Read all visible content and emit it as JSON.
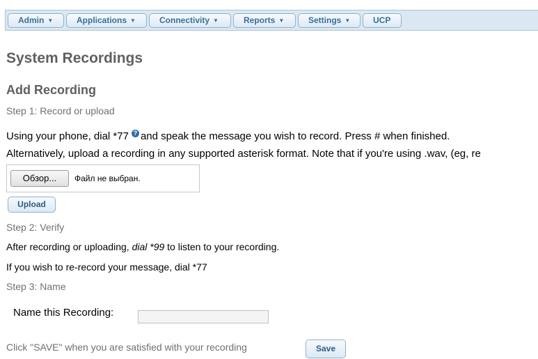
{
  "nav": {
    "items": [
      {
        "label": "Admin",
        "has_dropdown": true
      },
      {
        "label": "Applications",
        "has_dropdown": true
      },
      {
        "label": "Connectivity",
        "has_dropdown": true
      },
      {
        "label": "Reports",
        "has_dropdown": true
      },
      {
        "label": "Settings",
        "has_dropdown": true
      },
      {
        "label": "UCP",
        "has_dropdown": false
      }
    ],
    "caret": "▼"
  },
  "page_title": "System Recordings",
  "section_title": "Add Recording",
  "step1": {
    "label": "Step 1: Record or upload",
    "instruction_pre": "Using your phone, dial *77",
    "help_icon": "?",
    "instruction_post": "and speak the message you wish to record. Press # when finished.",
    "alternative": "Alternatively, upload a recording in any supported asterisk format. Note that if you're using .wav, (eg, re",
    "browse_label": "Обзор...",
    "file_status": "Файл не выбран.",
    "upload_label": "Upload"
  },
  "step2": {
    "label": "Step 2: Verify",
    "text_pre": "After recording or uploading,",
    "text_em": "dial *99",
    "text_post": "to listen to your recording.",
    "rerecord": "If you wish to re-record your message, dial *77"
  },
  "step3": {
    "label": "Step 3: Name",
    "name_label": "Name this Recording:",
    "name_value": ""
  },
  "save": {
    "prompt": "Click \"SAVE\" when you are satisfied with your recording",
    "button_label": "Save"
  },
  "colors": {
    "nav_bg": "#dbe8f3",
    "nav_text": "#3a6f98",
    "heading": "#606060",
    "help_icon": "#2d6ea7"
  }
}
